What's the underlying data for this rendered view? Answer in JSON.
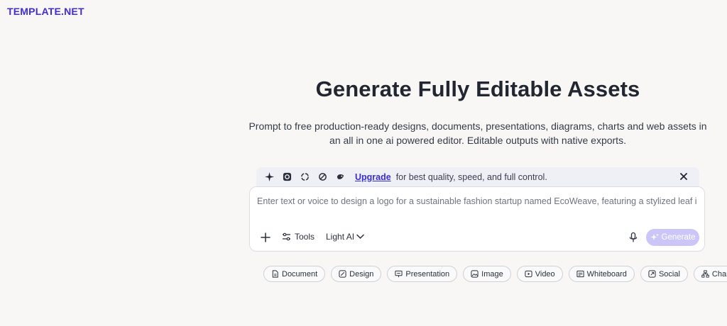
{
  "brand": {
    "logo_text": "TEMPLATE.NET"
  },
  "hero": {
    "title": "Generate Fully Editable Assets",
    "subtitle": "Prompt to free production-ready designs, documents, presentations, diagrams, charts and web assets in an all in one ai powered editor. Editable outputs with native exports."
  },
  "promo": {
    "icons": [
      "sparkle-icon",
      "openai-icon",
      "gemini-icon",
      "grok-icon",
      "deepseek-icon"
    ],
    "upgrade_label": "Upgrade",
    "message": "for best quality, speed, and full control."
  },
  "composer": {
    "placeholder": "Enter text or voice to design a logo for a sustainable fashion startup named EcoWeave, featuring a stylized leaf intertwin",
    "tools_label": "Tools",
    "model_label": "Light AI",
    "generate_label": "Generate"
  },
  "chips": [
    {
      "label": "Document",
      "icon": "document-icon"
    },
    {
      "label": "Design",
      "icon": "design-icon"
    },
    {
      "label": "Presentation",
      "icon": "presentation-icon"
    },
    {
      "label": "Image",
      "icon": "image-icon"
    },
    {
      "label": "Video",
      "icon": "video-icon"
    },
    {
      "label": "Whiteboard",
      "icon": "whiteboard-icon"
    },
    {
      "label": "Social",
      "icon": "social-icon"
    },
    {
      "label": "Chart",
      "icon": "chart-icon"
    }
  ],
  "colors": {
    "brand": "#3f2ce0",
    "generate_disabled": "#cbc6f7",
    "promo_bg": "#efeff6"
  }
}
